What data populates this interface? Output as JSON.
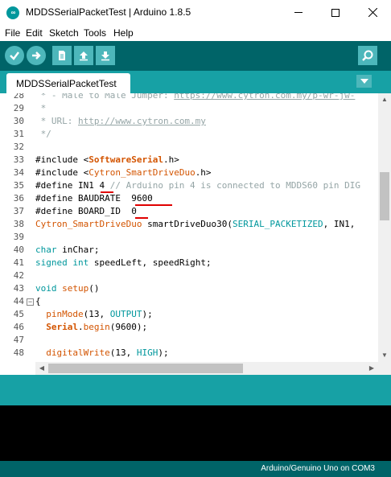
{
  "window": {
    "title": "MDDSSerialPacketTest | Arduino 1.8.5",
    "app_icon_glyph": "∞"
  },
  "menu": [
    "File",
    "Edit",
    "Sketch",
    "Tools",
    "Help"
  ],
  "toolbar": {
    "buttons": [
      "verify-icon",
      "upload-icon",
      "new-icon",
      "open-icon",
      "save-icon",
      "serial-monitor-icon"
    ]
  },
  "tabs": {
    "active": "MDDSSerialPacketTest"
  },
  "editor": {
    "line_numbers": [
      "28",
      "29",
      "30",
      "31",
      "32",
      "33",
      "34",
      "35",
      "36",
      "37",
      "38",
      "39",
      "40",
      "41",
      "42",
      "43",
      "44",
      "45",
      "46",
      "47",
      "48"
    ],
    "lines": {
      "l28": " * - Male to Male Jumper: https://www.cytron.com.my/p-wr-jw-",
      "l29": " *",
      "l30": " * URL: http://www.cytron.com.my",
      "l31": " */",
      "l32": "",
      "l33": "#include <SoftwareSerial.h>",
      "l34": "#include <Cytron_SmartDriveDuo.h>",
      "l35": "#define IN1 4 // Arduino pin 4 is connected to MDDS60 pin DIG",
      "l36": "#define BAUDRATE  9600",
      "l37": "#define BOARD_ID  0",
      "l38": "Cytron_SmartDriveDuo smartDriveDuo30(SERIAL_PACKETIZED, IN1,",
      "l39": "",
      "l40": "char inChar;",
      "l41": "signed int speedLeft, speedRight;",
      "l42": "",
      "l43": "void setup()",
      "l44": "{",
      "l45": "  pinMode(13, OUTPUT);",
      "l46": "  Serial.begin(9600);",
      "l47": "",
      "l48": "  digitalWrite(13, HIGH);"
    },
    "fold_marker": "−"
  },
  "footer": {
    "board": "Arduino/Genuino Uno on COM3"
  },
  "colors": {
    "toolbar": "#006468",
    "tabbar": "#17a1a5",
    "button": "#4db7bb",
    "annotation": "#e00000"
  }
}
